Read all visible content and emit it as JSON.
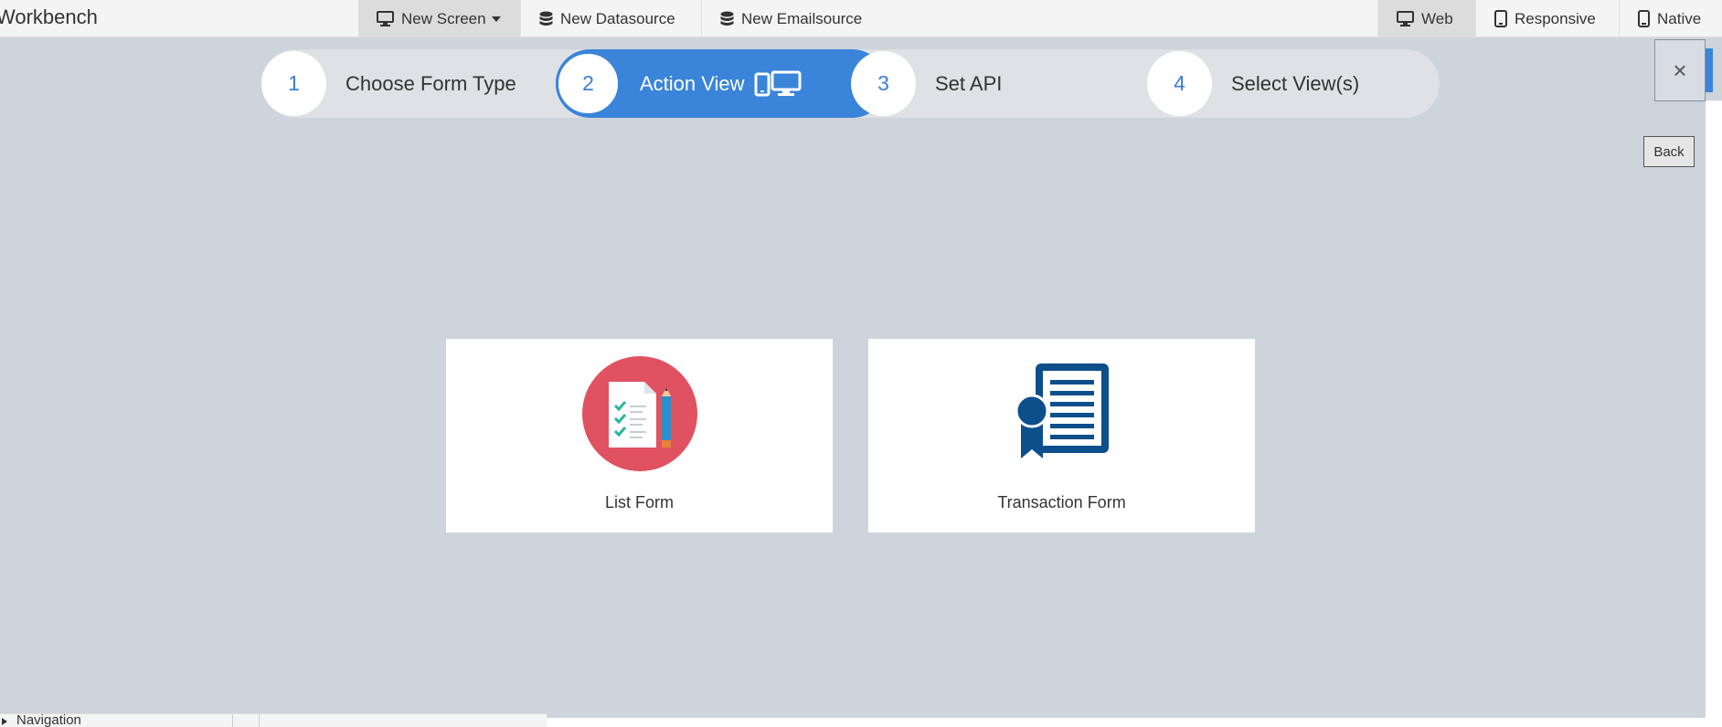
{
  "app": {
    "title": "Workbench"
  },
  "toolbar": {
    "new_screen": "New Screen",
    "new_datasource": "New Datasource",
    "new_emailsource": "New Emailsource",
    "web": "Web",
    "responsive": "Responsive",
    "native": "Native"
  },
  "wizard": {
    "steps": [
      {
        "number": "1",
        "label": "Choose Form Type"
      },
      {
        "number": "2",
        "label": "Action View",
        "active": true
      },
      {
        "number": "3",
        "label": "Set API"
      },
      {
        "number": "4",
        "label": "Select View(s)"
      }
    ],
    "close": "×",
    "back": "Back"
  },
  "cards": [
    {
      "label": "List Form",
      "icon": "list-form-icon"
    },
    {
      "label": "Transaction Form",
      "icon": "transaction-form-icon"
    }
  ],
  "bottom": {
    "navigation": "Navigation"
  },
  "colors": {
    "accent": "#3a84d9",
    "canvas": "#ced4dc",
    "list_icon_bg": "#e05262",
    "transaction_icon": "#0d4f8b"
  }
}
